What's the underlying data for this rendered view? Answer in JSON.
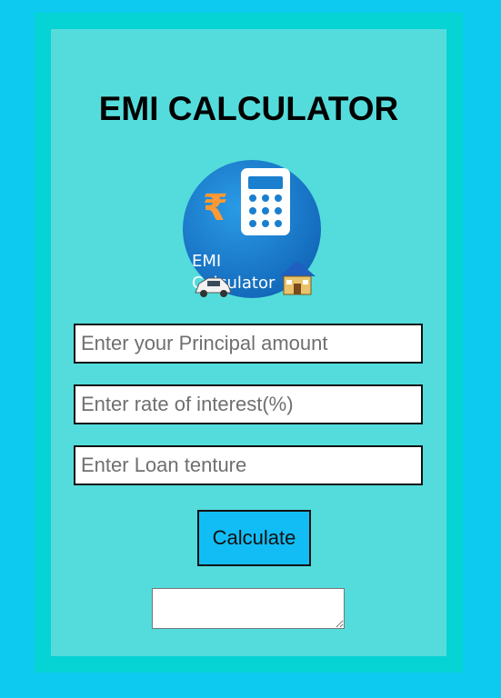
{
  "page": {
    "title": "EMI CALCULATOR"
  },
  "logo": {
    "icon": "emi-calculator-logo",
    "currency_symbol": "₹",
    "line1": "EMI",
    "line2": "Calculator"
  },
  "form": {
    "principal": {
      "placeholder": "Enter your Principal amount",
      "value": ""
    },
    "rate": {
      "placeholder": "Enter rate of interest(%)",
      "value": ""
    },
    "tenure": {
      "placeholder": "Enter Loan tenture",
      "value": ""
    },
    "calculate_label": "Calculate",
    "result": {
      "value": ""
    }
  },
  "colors": {
    "background": "#0ccaf0",
    "frame": "#06d3d3",
    "card": "#54dcdc",
    "button": "#12bdf5",
    "logo_circle": "#1a7fcf"
  }
}
